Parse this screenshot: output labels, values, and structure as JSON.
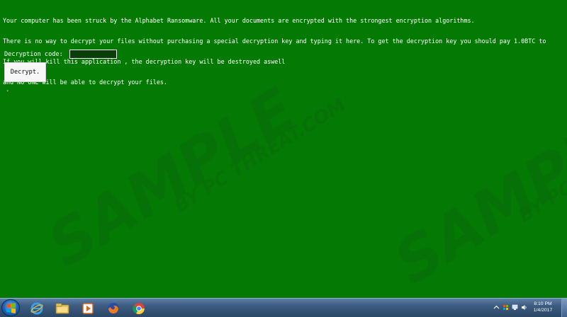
{
  "ransom_window": {
    "message_lines": [
      "Your computer has been struck by the Alphabet Ransomware. All your documents are encrypted with the strongest encryption algorithms.",
      "There is no way to decrypt your files without purchasing a special decryption key and typing it here. To get the decryption key you should pay 1.0BTC to",
      "If you will kill this application , the decryption key will be destroyed aswell",
      "and NO ONE will be able to decrypt your files."
    ],
    "decryption_label": "Decryption code:",
    "decryption_input_value": "",
    "decrypt_button_label": "Decrypt.",
    "status_text": ".",
    "background_color": "#047a04"
  },
  "watermark": {
    "text_main": "SAMPLE",
    "text_sub": "BY PC THREAT.COM"
  },
  "taskbar": {
    "start_icon": "windows-logo-icon",
    "pinned": [
      {
        "name": "internet-explorer-icon"
      },
      {
        "name": "file-explorer-icon"
      },
      {
        "name": "media-player-icon"
      },
      {
        "name": "firefox-icon"
      },
      {
        "name": "chrome-icon"
      }
    ],
    "tray_icons": [
      "arrow-up-icon",
      "flag-icon",
      "network-icon",
      "volume-icon"
    ],
    "clock_time": "8:10 PM",
    "clock_date": "1/4/2017"
  }
}
